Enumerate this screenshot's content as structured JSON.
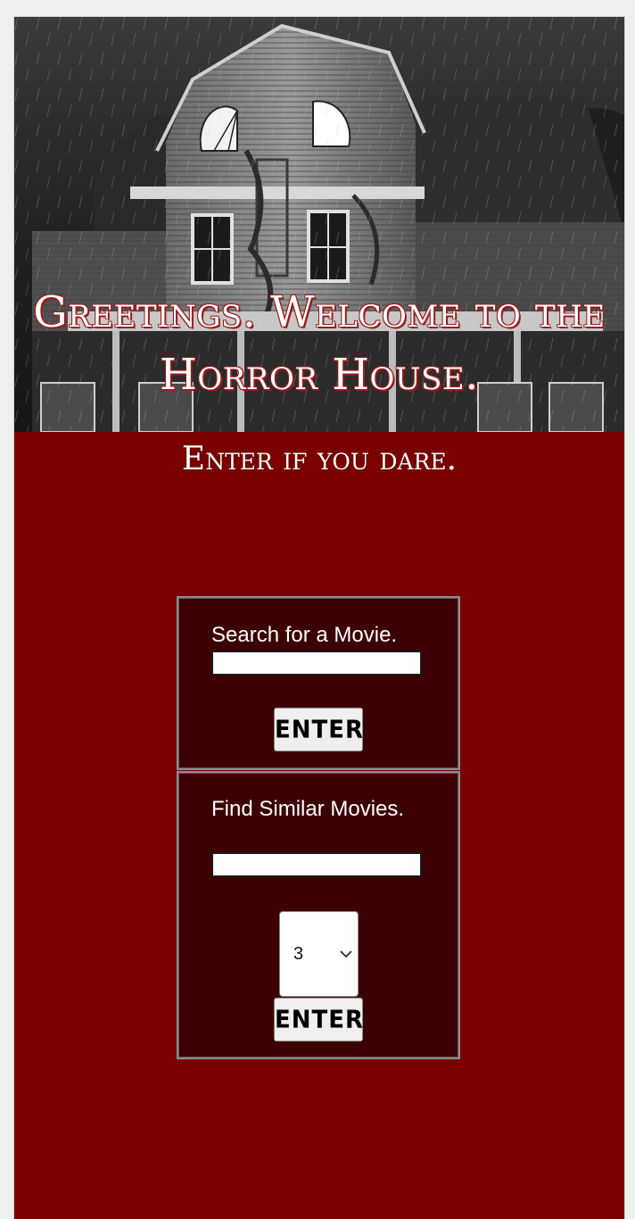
{
  "header": {
    "title": "Greetings. Welcome to the Horror House.",
    "tagline": "Enter if you dare."
  },
  "search_panel": {
    "label": "Search for a Movie.",
    "input_value": "",
    "button_label": "ENTER"
  },
  "similar_panel": {
    "label": "Find Similar Movies.",
    "input_value": "",
    "count_select_value": "3",
    "button_label": "ENTER"
  },
  "colors": {
    "page_background": "#7a0100",
    "panel_background": "#3c0102",
    "outer_background": "#eef0ef"
  }
}
